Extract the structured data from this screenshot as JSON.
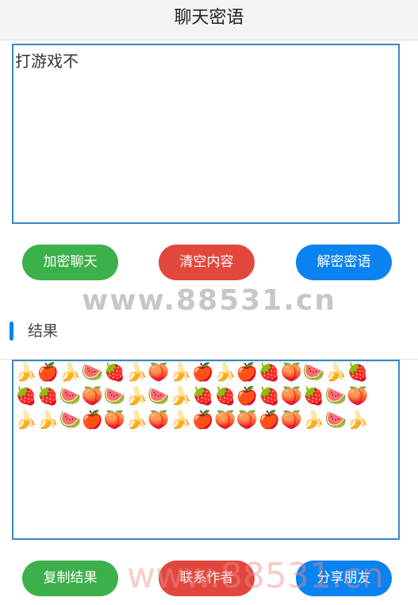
{
  "header": {
    "title": "聊天密语"
  },
  "input": {
    "value": "打游戏不"
  },
  "buttons_top": {
    "encrypt": "加密聊天",
    "clear": "清空内容",
    "decrypt": "解密密语"
  },
  "watermark": {
    "text": "www.88531.cn"
  },
  "result_section": {
    "label": "结果"
  },
  "result": {
    "lines": [
      "🍌🍎🍌🍉🍓🍌🍑🍌🍎🍌🍎🍓🍑🍉🍌🍓",
      "🍓🍓🍉🍑🍉🍌🍉🍌🍓🍓🍎🍓🍑🍓🍉🍑",
      "🍌🍌🍉🍎🍑🍌🍑🍌🍎🍑🍑🍎🍑🍌🍉🍌"
    ]
  },
  "buttons_bottom": {
    "copy": "复制结果",
    "contact": "联系作者",
    "share": "分享朋友"
  },
  "watermark_bottom": {
    "text": "www.88531.cn"
  },
  "colors": {
    "green": "#3cb04a",
    "red": "#e2473e",
    "blue": "#0a82f0",
    "textbox_border": "#3b86c6"
  }
}
